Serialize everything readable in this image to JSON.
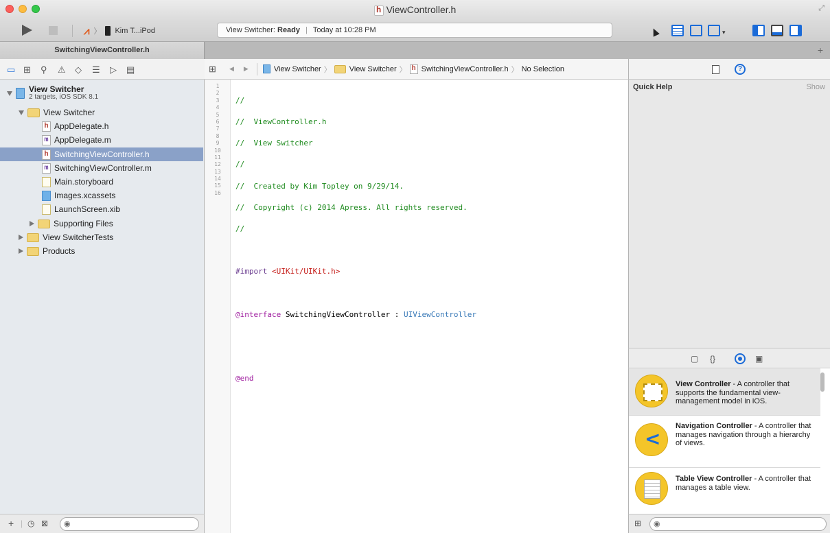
{
  "window": {
    "title": "ViewController.h",
    "title_file_badge": "h"
  },
  "toolbar": {
    "scheme_target": "Kim T...iPod",
    "activity_app": "View Switcher:",
    "activity_status": "Ready",
    "activity_time": "Today at 10:28 PM"
  },
  "tabs": {
    "active": "SwitchingViewController.h",
    "add": "+"
  },
  "navigator": {
    "project": {
      "name": "View Switcher",
      "subtitle": "2 targets, iOS SDK 8.1"
    },
    "group": "View Switcher",
    "files": [
      {
        "badge": "h",
        "name": "AppDelegate.h"
      },
      {
        "badge": "m",
        "name": "AppDelegate.m"
      },
      {
        "badge": "h",
        "name": "SwitchingViewController.h",
        "selected": true
      },
      {
        "badge": "m",
        "name": "SwitchingViewController.m"
      },
      {
        "badge": "",
        "name": "Main.storyboard"
      },
      {
        "badge": "",
        "name": "Images.xcassets"
      },
      {
        "badge": "",
        "name": "LaunchScreen.xib"
      }
    ],
    "subgroups": [
      "Supporting Files",
      "View SwitcherTests",
      "Products"
    ]
  },
  "jumpbar": {
    "crumbs": [
      "View Switcher",
      "View Switcher",
      "SwitchingViewController.h",
      "No Selection"
    ],
    "file_badge": "h"
  },
  "editor": {
    "line_numbers": [
      "1",
      "2",
      "3",
      "4",
      "5",
      "6",
      "7",
      "8",
      "9",
      "10",
      "11",
      "12",
      "13",
      "14",
      "15",
      "16"
    ],
    "lines": {
      "l1": "//",
      "l2": "//  ViewController.h",
      "l3": "//  View Switcher",
      "l4": "//",
      "l5": "//  Created by Kim Topley on 9/29/14.",
      "l6": "//  Copyright (c) 2014 Apress. All rights reserved.",
      "l7": "//",
      "l9_directive": "#import",
      "l9_path": "<UIKit/UIKit.h>",
      "l11_keyword": "@interface",
      "l11_name": " SwitchingViewController : ",
      "l11_super": "UIViewController",
      "l14_end": "@end"
    }
  },
  "inspector": {
    "title": "Quick Help",
    "show": "Show"
  },
  "library": {
    "items": [
      {
        "title": "View Controller",
        "desc": " - A controller that supports the fundamental view-management model in iOS."
      },
      {
        "title": "Navigation Controller",
        "desc": " - A controller that manages navigation through a hierarchy of views."
      },
      {
        "title": "Table View Controller",
        "desc": " - A controller that manages a table view."
      }
    ]
  }
}
